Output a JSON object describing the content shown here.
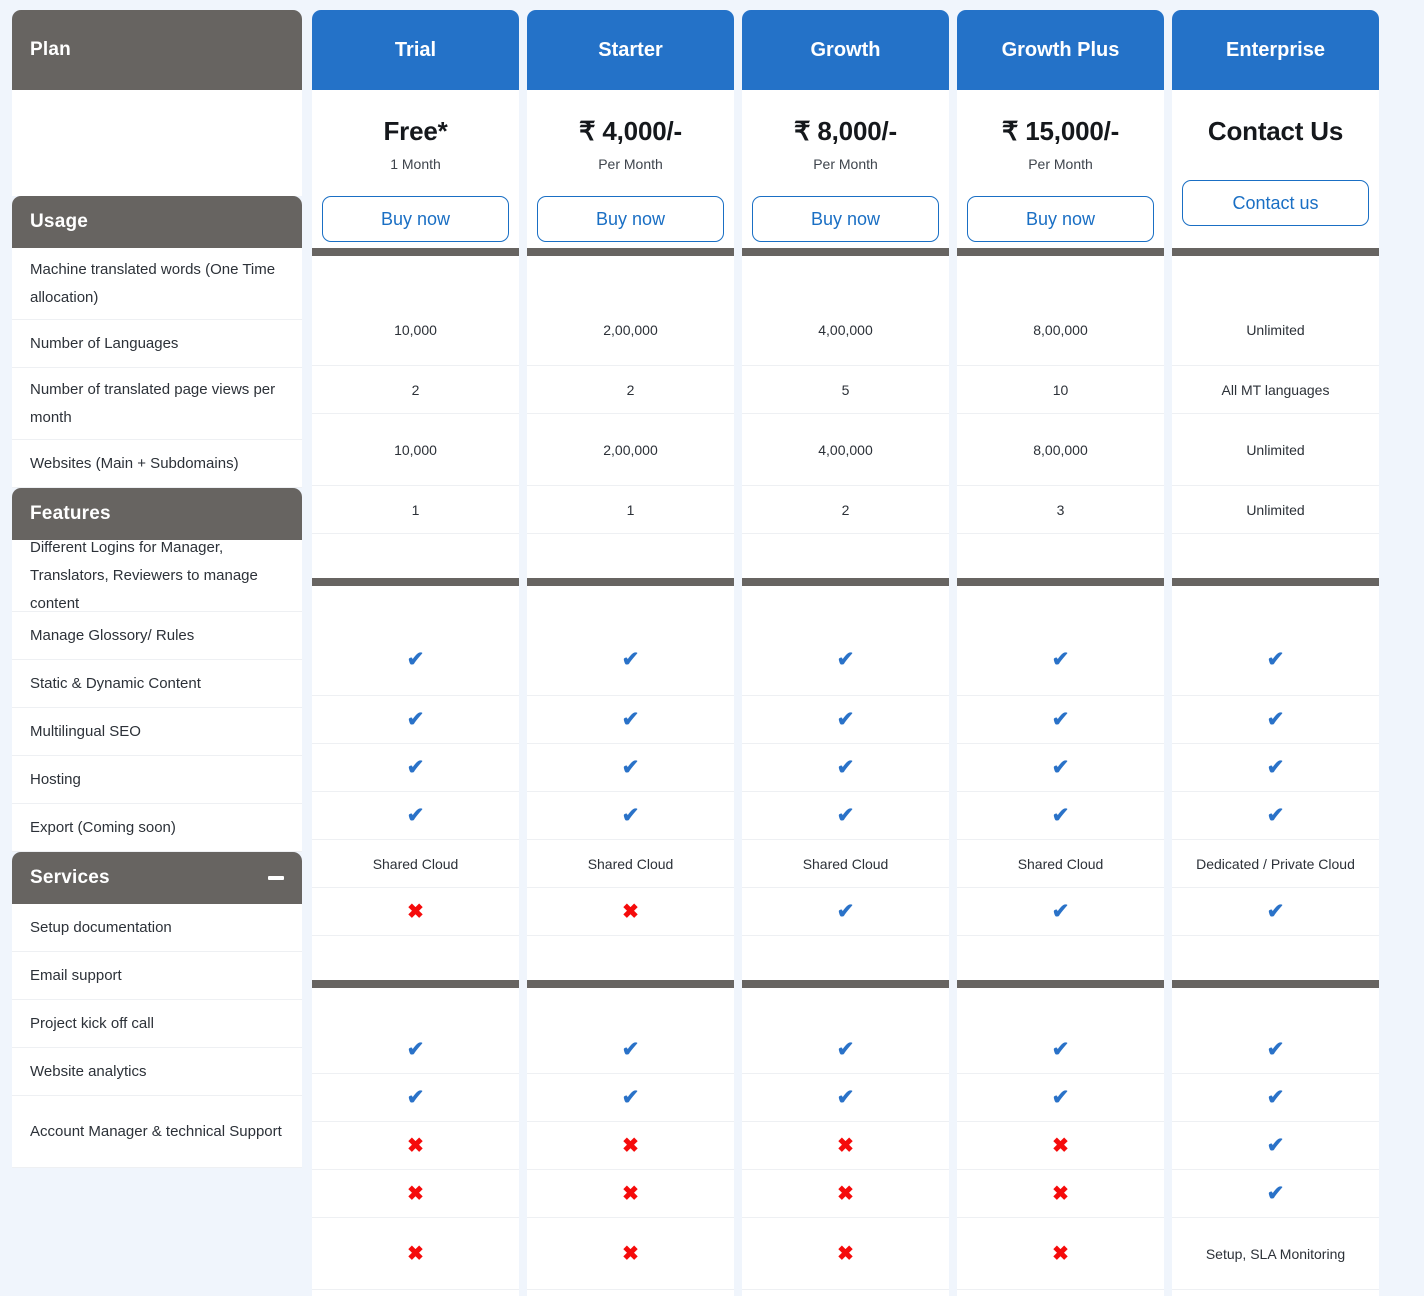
{
  "columns": {
    "feature_header": "Plan",
    "plans": [
      {
        "name": "Trial",
        "price": "Free*",
        "period": "1 Month",
        "cta": "Buy now"
      },
      {
        "name": "Starter",
        "price": "₹ 4,000/-",
        "period": "Per Month",
        "cta": "Buy now"
      },
      {
        "name": "Growth",
        "price": "₹ 8,000/-",
        "period": "Per Month",
        "cta": "Buy now"
      },
      {
        "name": "Growth Plus",
        "price": "₹ 15,000/-",
        "period": "Per Month",
        "cta": "Buy now"
      },
      {
        "name": "Enterprise",
        "price": "Contact Us",
        "period": "",
        "cta": "Contact us"
      }
    ]
  },
  "sections": [
    {
      "title": "Usage",
      "collapsible": false,
      "rows": [
        {
          "label": "Machine translated words (One Time allocation)",
          "tall": true,
          "values": [
            "10,000",
            "2,00,000",
            "4,00,000",
            "8,00,000",
            "Unlimited"
          ]
        },
        {
          "label": "Number of Languages",
          "tall": false,
          "values": [
            "2",
            "2",
            "5",
            "10",
            "All MT languages"
          ]
        },
        {
          "label": "Number of translated page views per month",
          "tall": true,
          "values": [
            "10,000",
            "2,00,000",
            "4,00,000",
            "8,00,000",
            "Unlimited"
          ]
        },
        {
          "label": "Websites (Main + Subdomains)",
          "tall": false,
          "values": [
            "1",
            "1",
            "2",
            "3",
            "Unlimited"
          ]
        }
      ]
    },
    {
      "title": "Features",
      "collapsible": false,
      "rows": [
        {
          "label": "Different Logins for Manager, Translators, Reviewers to manage content",
          "tall": true,
          "values": [
            "check",
            "check",
            "check",
            "check",
            "check"
          ]
        },
        {
          "label": "Manage Glossory/ Rules",
          "tall": false,
          "values": [
            "check",
            "check",
            "check",
            "check",
            "check"
          ]
        },
        {
          "label": "Static & Dynamic Content",
          "tall": false,
          "values": [
            "check",
            "check",
            "check",
            "check",
            "check"
          ]
        },
        {
          "label": "Multilingual SEO",
          "tall": false,
          "values": [
            "check",
            "check",
            "check",
            "check",
            "check"
          ]
        },
        {
          "label": "Hosting",
          "tall": false,
          "values": [
            "Shared Cloud",
            "Shared Cloud",
            "Shared Cloud",
            "Shared Cloud",
            "Dedicated / Private Cloud"
          ]
        },
        {
          "label": "Export (Coming soon)",
          "tall": false,
          "values": [
            "cross",
            "cross",
            "check",
            "check",
            "check"
          ]
        }
      ]
    },
    {
      "title": "Services",
      "collapsible": true,
      "collapse_icon": "minus-icon",
      "rows": [
        {
          "label": "Setup documentation",
          "tall": false,
          "values": [
            "check",
            "check",
            "check",
            "check",
            "check"
          ]
        },
        {
          "label": "Email support",
          "tall": false,
          "values": [
            "check",
            "check",
            "check",
            "check",
            "check"
          ]
        },
        {
          "label": "Project kick off call",
          "tall": false,
          "values": [
            "cross",
            "cross",
            "cross",
            "cross",
            "check"
          ]
        },
        {
          "label": "Website analytics",
          "tall": false,
          "values": [
            "cross",
            "cross",
            "cross",
            "cross",
            "check"
          ]
        },
        {
          "label": "Account Manager & technical Support",
          "tall": true,
          "values": [
            "cross",
            "cross",
            "cross",
            "cross",
            "Setup, SLA Monitoring"
          ]
        }
      ]
    }
  ],
  "glyphs": {
    "check": "✔",
    "cross": "✖"
  },
  "colors": {
    "page_background": "#f0f5fc",
    "section_header": "#676461",
    "plan_header": "#2472c8",
    "accent_blue": "#1a6fc4",
    "check": "#2a72c8",
    "cross": "#f50b0b"
  }
}
